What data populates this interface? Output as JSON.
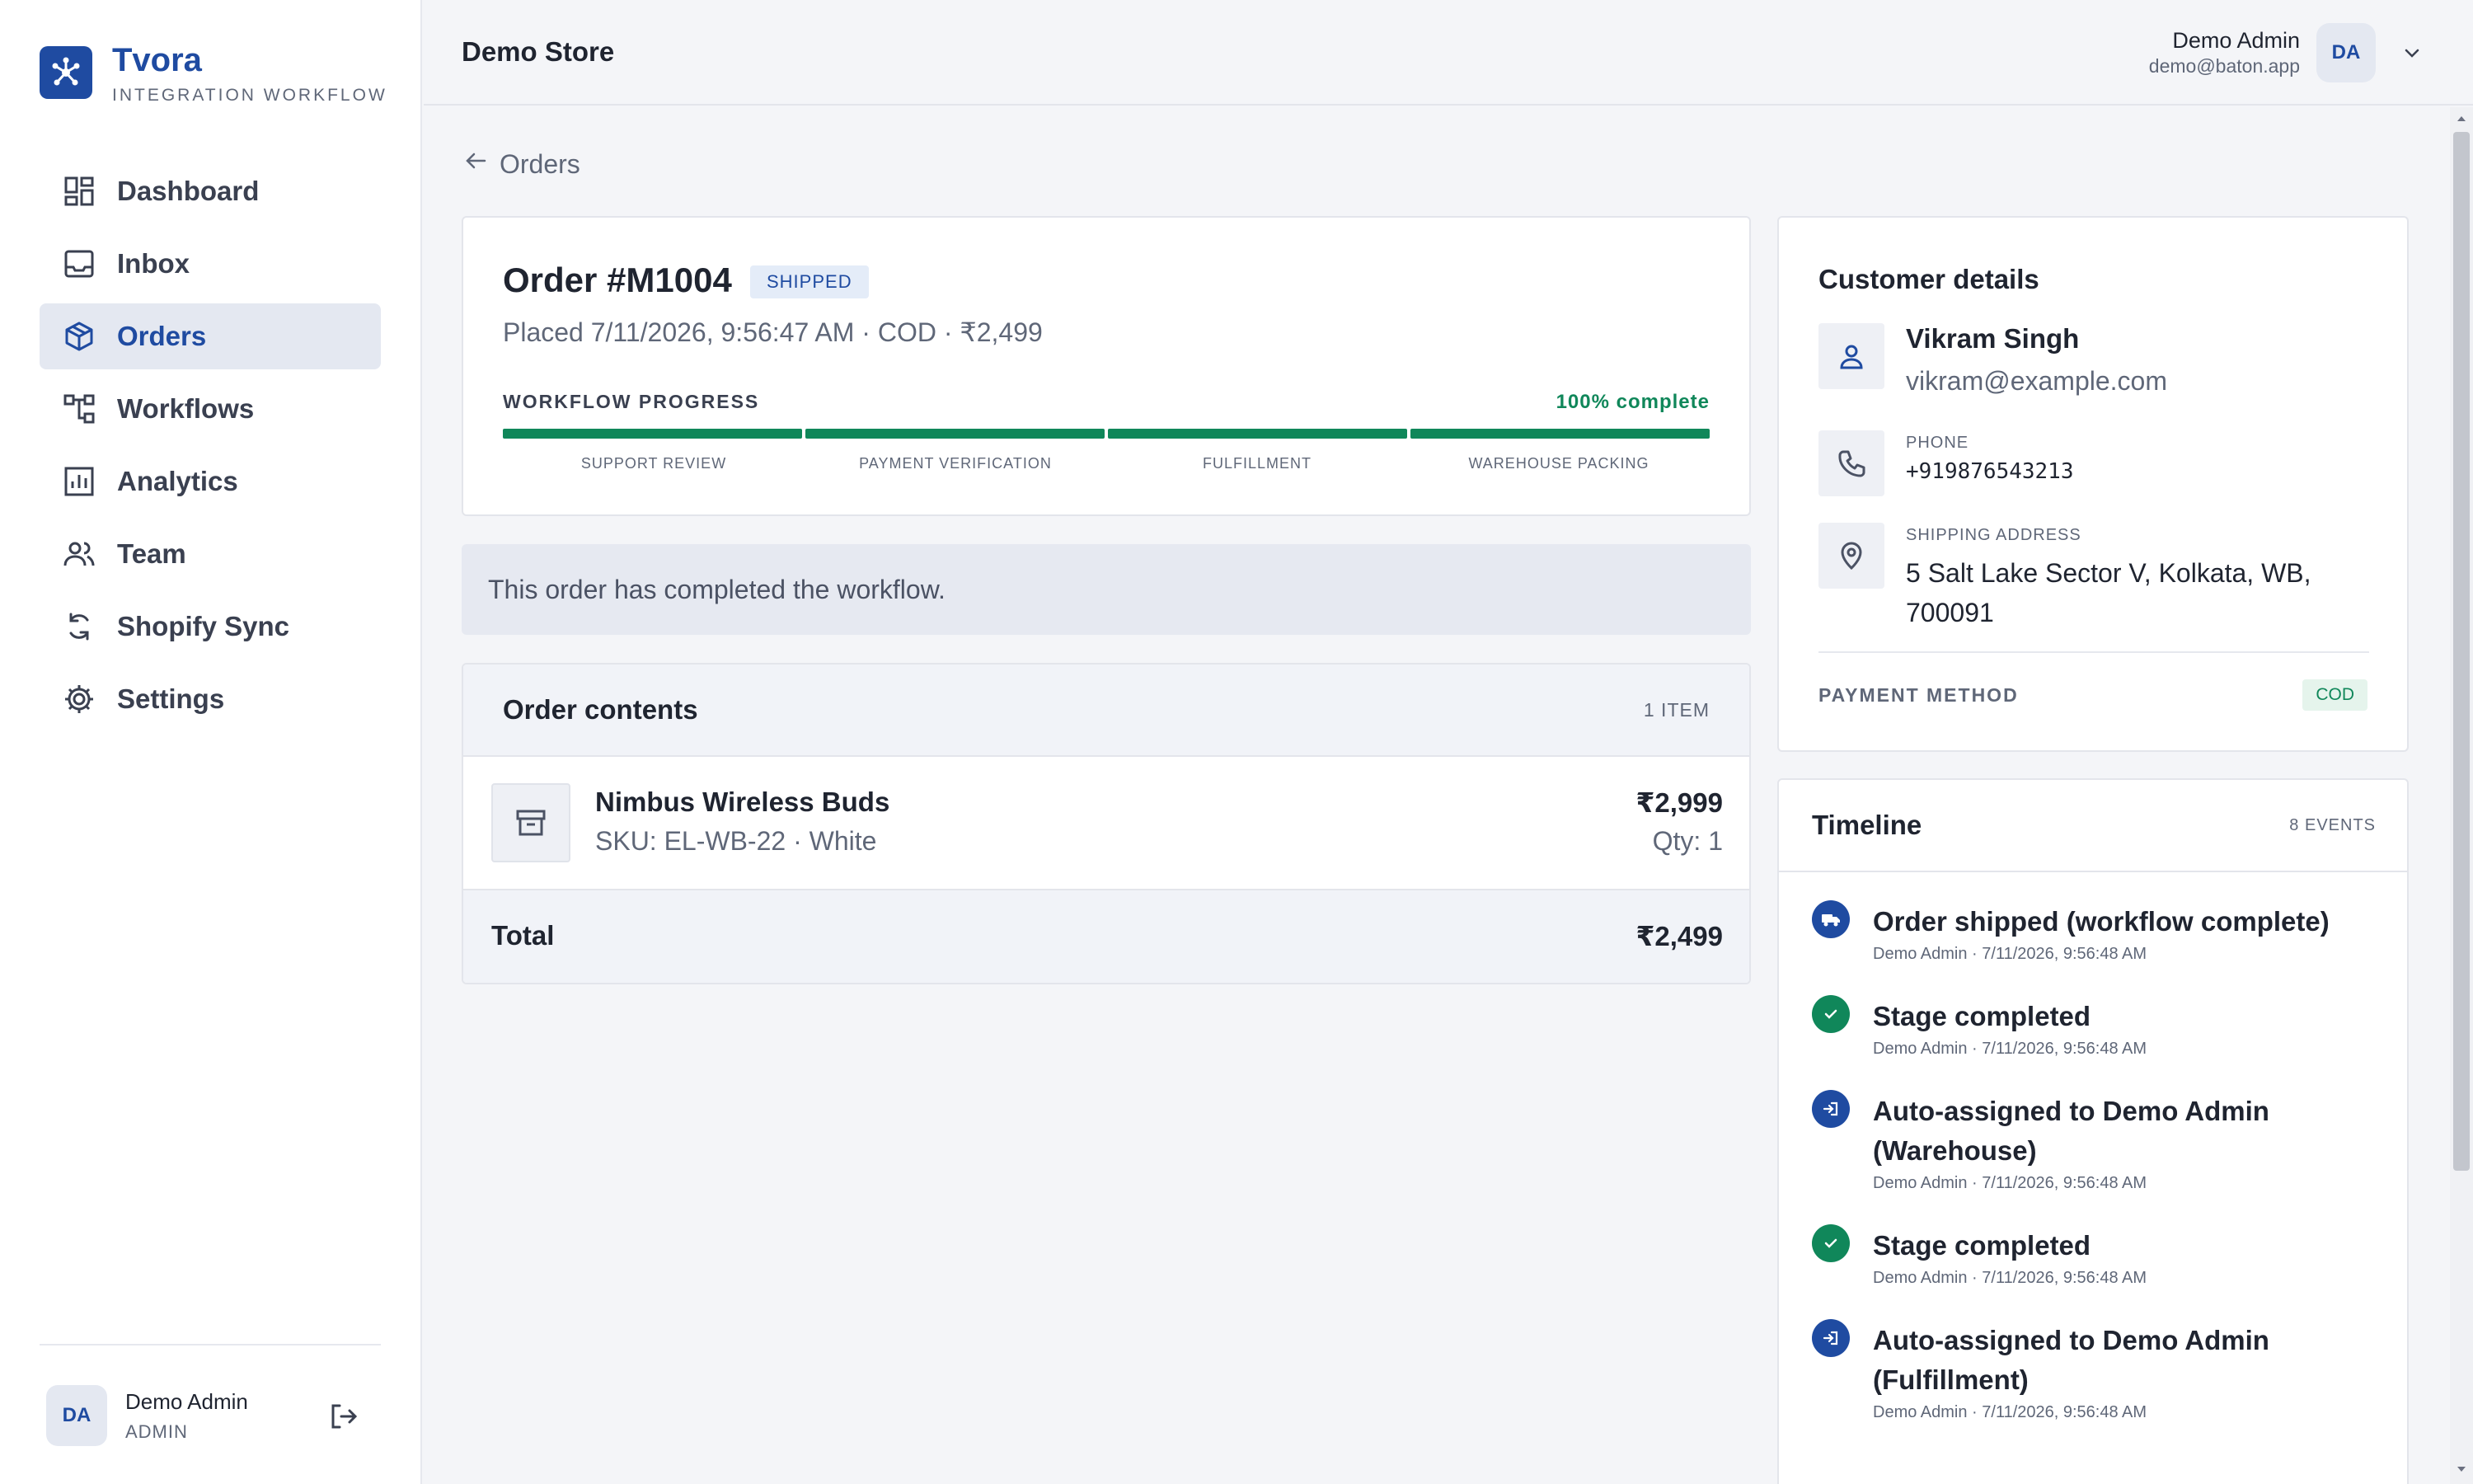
{
  "brand": {
    "name": "Tvora",
    "subtitle": "INTEGRATION WORKFLOW"
  },
  "sidebar": {
    "items": [
      {
        "label": "Dashboard",
        "icon": "dashboard-icon",
        "active": false
      },
      {
        "label": "Inbox",
        "icon": "inbox-icon",
        "active": false
      },
      {
        "label": "Orders",
        "icon": "box-icon",
        "active": true
      },
      {
        "label": "Workflows",
        "icon": "workflow-icon",
        "active": false
      },
      {
        "label": "Analytics",
        "icon": "analytics-icon",
        "active": false
      },
      {
        "label": "Team",
        "icon": "team-icon",
        "active": false
      },
      {
        "label": "Shopify Sync",
        "icon": "sync-icon",
        "active": false
      },
      {
        "label": "Settings",
        "icon": "gear-icon",
        "active": false
      }
    ],
    "user": {
      "initials": "DA",
      "name": "Demo Admin",
      "role": "ADMIN"
    }
  },
  "header": {
    "store": "Demo Store",
    "user": {
      "name": "Demo Admin",
      "email": "demo@baton.app",
      "initials": "DA"
    }
  },
  "back_label": "Orders",
  "order": {
    "title": "Order #M1004",
    "status": "SHIPPED",
    "meta": "Placed 7/11/2026, 9:56:47 AM · COD · ₹2,499",
    "workflow": {
      "label": "WORKFLOW PROGRESS",
      "percent_label": "100% complete",
      "progress_fraction": 1.0,
      "stages": [
        "SUPPORT REVIEW",
        "PAYMENT VERIFICATION",
        "FULFILLMENT",
        "WAREHOUSE PACKING"
      ]
    }
  },
  "notice": "This order has completed the workflow.",
  "contents": {
    "title": "Order contents",
    "count": "1 ITEM",
    "item": {
      "name": "Nimbus Wireless Buds",
      "sku": "SKU: EL-WB-22 · White",
      "price": "₹2,999",
      "qty": "Qty: 1"
    },
    "total_label": "Total",
    "total_value": "₹2,499"
  },
  "customer": {
    "title": "Customer details",
    "name": "Vikram Singh",
    "email": "vikram@example.com",
    "phone_label": "PHONE",
    "phone": "+919876543213",
    "address_label": "SHIPPING ADDRESS",
    "address": "5 Salt Lake Sector V, Kolkata, WB, 700091",
    "payment_label": "PAYMENT METHOD",
    "payment_value": "COD"
  },
  "timeline": {
    "title": "Timeline",
    "count": "8 EVENTS",
    "events": [
      {
        "text": "Order shipped (workflow complete)",
        "meta": "Demo Admin · 7/11/2026, 9:56:48 AM",
        "icon": "truck-icon",
        "color": "blue"
      },
      {
        "text": "Stage completed",
        "meta": "Demo Admin · 7/11/2026, 9:56:48 AM",
        "icon": "check-icon",
        "color": "green"
      },
      {
        "text": "Auto-assigned to Demo Admin (Warehouse)",
        "meta": "Demo Admin · 7/11/2026, 9:56:48 AM",
        "icon": "assign-icon",
        "color": "blue"
      },
      {
        "text": "Stage completed",
        "meta": "Demo Admin · 7/11/2026, 9:56:48 AM",
        "icon": "check-icon",
        "color": "green"
      },
      {
        "text": "Auto-assigned to Demo Admin (Fulfillment)",
        "meta": "Demo Admin · 7/11/2026, 9:56:48 AM",
        "icon": "assign-icon",
        "color": "blue"
      }
    ]
  },
  "colors": {
    "accent": "#1f4ba1",
    "success": "#10875a"
  }
}
